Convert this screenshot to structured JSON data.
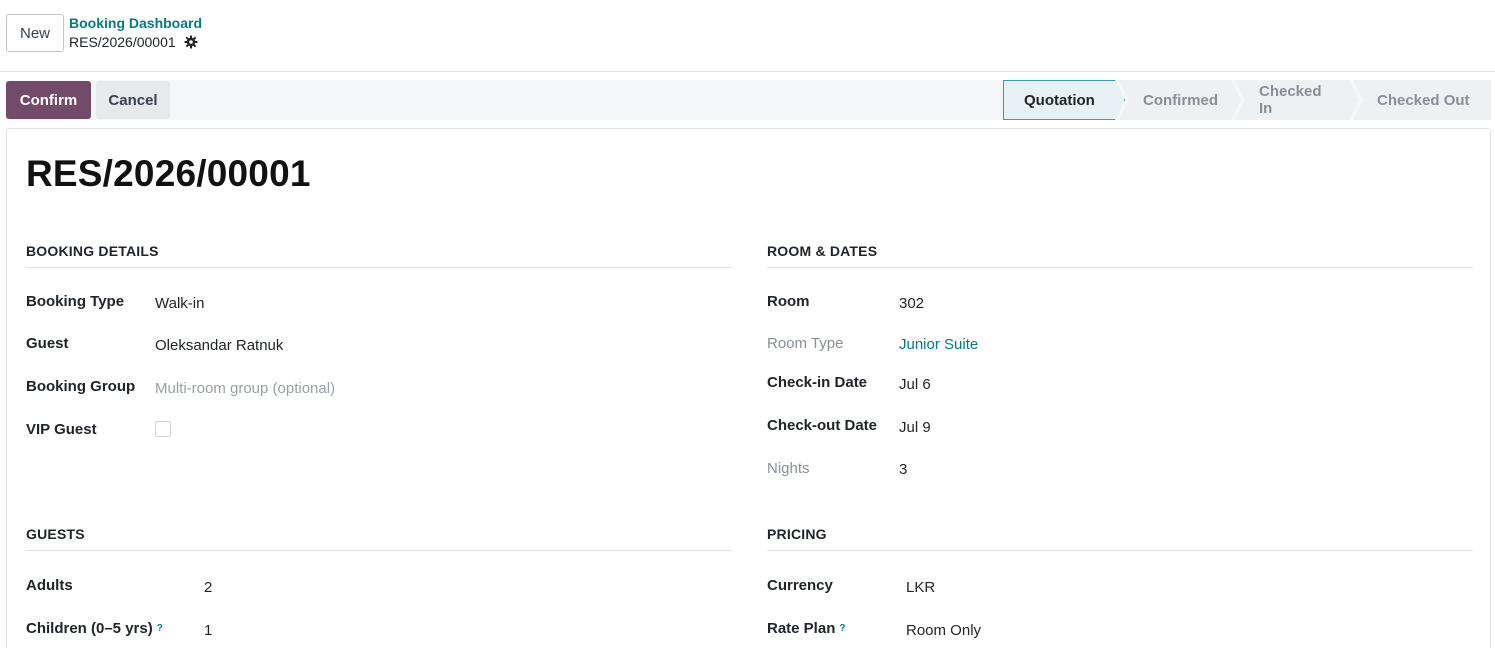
{
  "control_panel": {
    "new_label": "New",
    "breadcrumb_parent": "Booking Dashboard",
    "breadcrumb_current": "RES/2026/00001",
    "settings_icon": "gear-icon"
  },
  "statusbar": {
    "confirm_label": "Confirm",
    "cancel_label": "Cancel",
    "stages": [
      "Quotation",
      "Confirmed",
      "Checked In",
      "Checked Out"
    ],
    "active_stage": "Quotation"
  },
  "record": {
    "title": "RES/2026/00001"
  },
  "booking_details": {
    "title": "BOOKING DETAILS",
    "booking_type_label": "Booking Type",
    "booking_type_value": "Walk-in",
    "guest_label": "Guest",
    "guest_value": "Oleksandar Ratnuk",
    "booking_group_label": "Booking Group",
    "booking_group_placeholder": "Multi-room group (optional)",
    "vip_label": "VIP Guest",
    "vip_checked": false
  },
  "room_dates": {
    "title": "ROOM & DATES",
    "room_label": "Room",
    "room_value": "302",
    "room_type_label": "Room Type",
    "room_type_value": "Junior Suite",
    "checkin_label": "Check-in Date",
    "checkin_value": "Jul 6",
    "checkout_label": "Check-out Date",
    "checkout_value": "Jul 9",
    "nights_label": "Nights",
    "nights_value": "3"
  },
  "guests": {
    "title": "GUESTS",
    "adults_label": "Adults",
    "adults_value": "2",
    "children_label": "Children (0–5 yrs)",
    "children_help": "?",
    "children_value": "1"
  },
  "pricing": {
    "title": "PRICING",
    "currency_label": "Currency",
    "currency_value": "LKR",
    "rate_plan_label": "Rate Plan",
    "rate_plan_help": "?",
    "rate_plan_value": "Room Only"
  },
  "colors": {
    "primary": "#714b67",
    "link": "#017e84"
  }
}
